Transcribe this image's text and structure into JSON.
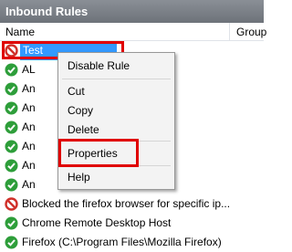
{
  "panel": {
    "title": "Inbound Rules"
  },
  "columns": {
    "name": "Name",
    "group": "Group"
  },
  "rules": [
    {
      "label": "Test",
      "icon": "blocked-icon"
    },
    {
      "label": "AL",
      "icon": "allowed-icon"
    },
    {
      "label": "An",
      "icon": "allowed-icon"
    },
    {
      "label": "An",
      "icon": "allowed-icon"
    },
    {
      "label": "An",
      "icon": "allowed-icon"
    },
    {
      "label": "An",
      "icon": "allowed-icon"
    },
    {
      "label": "An",
      "icon": "allowed-icon"
    },
    {
      "label": "An",
      "icon": "allowed-icon"
    },
    {
      "label": "Blocked the firefox browser for specific ip...",
      "icon": "blocked-icon"
    },
    {
      "label": "Chrome Remote Desktop Host",
      "icon": "allowed-icon"
    },
    {
      "label": "Firefox (C:\\Program Files\\Mozilla Firefox)",
      "icon": "allowed-icon"
    }
  ],
  "context_menu": {
    "disable_rule": "Disable Rule",
    "cut": "Cut",
    "copy": "Copy",
    "delete": "Delete",
    "properties": "Properties",
    "help": "Help"
  },
  "colors": {
    "allowed": "#2e9e3a",
    "blocked": "#d0302a",
    "selection": "#3399ff",
    "highlight_box": "#e00000"
  }
}
